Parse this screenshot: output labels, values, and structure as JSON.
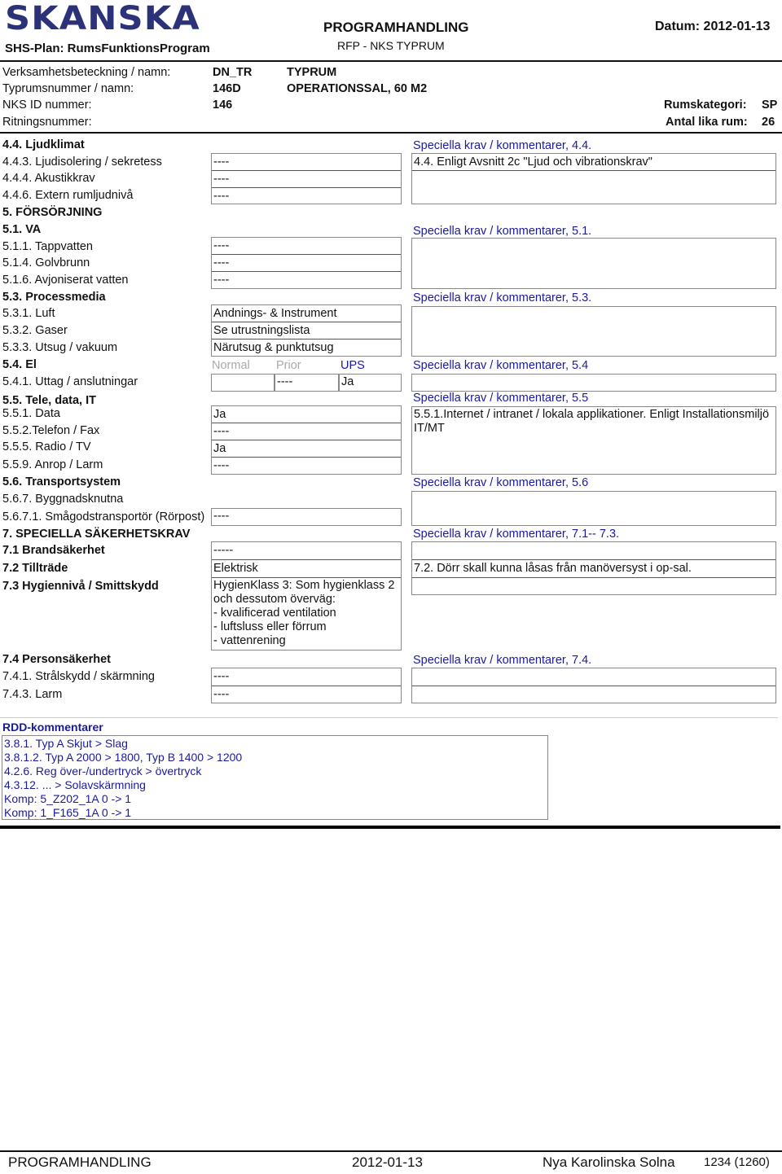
{
  "header": {
    "logo": "SKANSKA",
    "subtitle": "SHS-Plan: RumsFunktionsProgram",
    "title": "PROGRAMHANDLING",
    "subheading": "RFP -  NKS TYPRUM",
    "date_label": "Datum: 2012-01-13"
  },
  "meta": {
    "verksamhet_label": "Verksamhetsbeteckning / namn:",
    "verksamhet_code": "DN_TR",
    "verksamhet_name": "TYPRUM",
    "typrum_label": "Typrumsnummer / namn:",
    "typrum_code": "146D",
    "typrum_name": "OPERATIONSSAL, 60 M2",
    "nks_label": "NKS ID nummer:",
    "nks_value": "146",
    "ritning_label": "Ritningsnummer:",
    "rumskategori_label": "Rumskategori:",
    "rumskategori_value": "SP",
    "antal_label": "Antal lika rum:",
    "antal_value": "26"
  },
  "sections": {
    "s44": {
      "title": "4.4. Ljudklimat",
      "items": [
        {
          "label": "4.4.3. Ljudisolering / sekretess",
          "value": "----"
        },
        {
          "label": "4.4.4. Akustikkrav",
          "value": "----"
        },
        {
          "label": "4.4.6. Extern rumljudnivå",
          "value": "----"
        }
      ],
      "comment_label": "Speciella krav / kommentarer, 4.4.",
      "comments": [
        "4.4. Enligt Avsnitt 2c \"Ljud och vibrationskrav\"",
        ""
      ]
    },
    "s5": {
      "title": "5. FÖRSÖRJNING"
    },
    "s51": {
      "title": "5.1. VA",
      "items": [
        {
          "label": "5.1.1. Tappvatten",
          "value": "----"
        },
        {
          "label": "5.1.4. Golvbrunn",
          "value": "----"
        },
        {
          "label": "5.1.6. Avjoniserat vatten",
          "value": "----"
        }
      ],
      "comment_label": "Speciella krav / kommentarer, 5.1.",
      "comment": ""
    },
    "s53": {
      "title": "5.3. Processmedia",
      "items": [
        {
          "label": "5.3.1. Luft",
          "value": "Andnings- & Instrument"
        },
        {
          "label": "5.3.2. Gaser",
          "value": "Se utrustningslista"
        },
        {
          "label": "5.3.3. Utsug / vakuum",
          "value": "Närutsug & punktutsug"
        }
      ],
      "comment_label": "Speciella krav / kommentarer, 5.3.",
      "comment": ""
    },
    "s54": {
      "title": "5.4. El",
      "col_normal": "Normal",
      "col_prior": "Prior",
      "col_ups": "UPS",
      "item_label": "5.4.1. Uttag / anslutningar",
      "normal": "",
      "prior": "----",
      "ups": "Ja",
      "comment_label": "Speciella krav / kommentarer, 5.4",
      "comment": ""
    },
    "s55": {
      "title": "5.5. Tele, data, IT",
      "items": [
        {
          "label": "5.5.1. Data",
          "value": "Ja"
        },
        {
          "label": "5.5.2.Telefon / Fax",
          "value": "----"
        },
        {
          "label": "5.5.5. Radio / TV",
          "value": "Ja"
        },
        {
          "label": "5.5.9. Anrop / Larm",
          "value": "----"
        }
      ],
      "comment_label": "Speciella krav / kommentarer, 5.5",
      "comment": "5.5.1.Internet / intranet / lokala applikationer. Enligt Installationsmiljö IT/MT"
    },
    "s56": {
      "title": "5.6. Transportsystem",
      "sub": "5.6.7. Byggnadsknutna",
      "items": [
        {
          "label": "5.6.7.1. Smågodstransportör (Rörpost)",
          "value": "----"
        }
      ],
      "comment_label": "Speciella krav / kommentarer,  5.6",
      "comment": ""
    },
    "s7": {
      "title": "7. SPECIELLA SÄKERHETSKRAV",
      "items": [
        {
          "label": "7.1 Brandsäkerhet",
          "value": "-----"
        },
        {
          "label": "7.2 Tillträde",
          "value": "Elektrisk"
        },
        {
          "label": "7.3 Hygiennivå / Smittskydd",
          "value": "HygienKlass 3: Som hygienklass 2 och dessutom överväg:\n- kvalificerad ventilation\n- luftsluss eller förrum\n- vattenrening"
        }
      ],
      "comment_label": "Speciella krav / kommentarer, 7.1-- 7.3.",
      "comments": [
        "",
        "7.2. Dörr skall kunna låsas från manöversyst i op-sal.",
        ""
      ]
    },
    "s74": {
      "title": "7.4 Personsäkerhet",
      "items": [
        {
          "label": "7.4.1. Strålskydd / skärmning",
          "value": "----"
        },
        {
          "label": "7.4.3. Larm",
          "value": "----"
        }
      ],
      "comment_label": "Speciella krav / kommentarer, 7.4.",
      "comments": [
        "",
        ""
      ]
    }
  },
  "rdd": {
    "title": "RDD-kommentarer",
    "lines": [
      "3.8.1. Typ A Skjut > Slag",
      "3.8.1.2. Typ A 2000 > 1800, Typ B 1400 > 1200",
      "4.2.6. Reg över-/undertryck > övertryck",
      "4.3.12. ... > Solavskärmning",
      "Komp: 5_Z202_1A 0 -> 1",
      "Komp: 1_F165_1A 0 -> 1"
    ]
  },
  "footer": {
    "left": "PROGRAMHANDLING",
    "date": "2012-01-13",
    "project": "Nya Karolinska Solna",
    "page": "1234 (1260)"
  },
  "colors": {
    "brand": "#2c3277",
    "comment_label": "#1a1aa0",
    "muted": "#aaaaaa"
  }
}
